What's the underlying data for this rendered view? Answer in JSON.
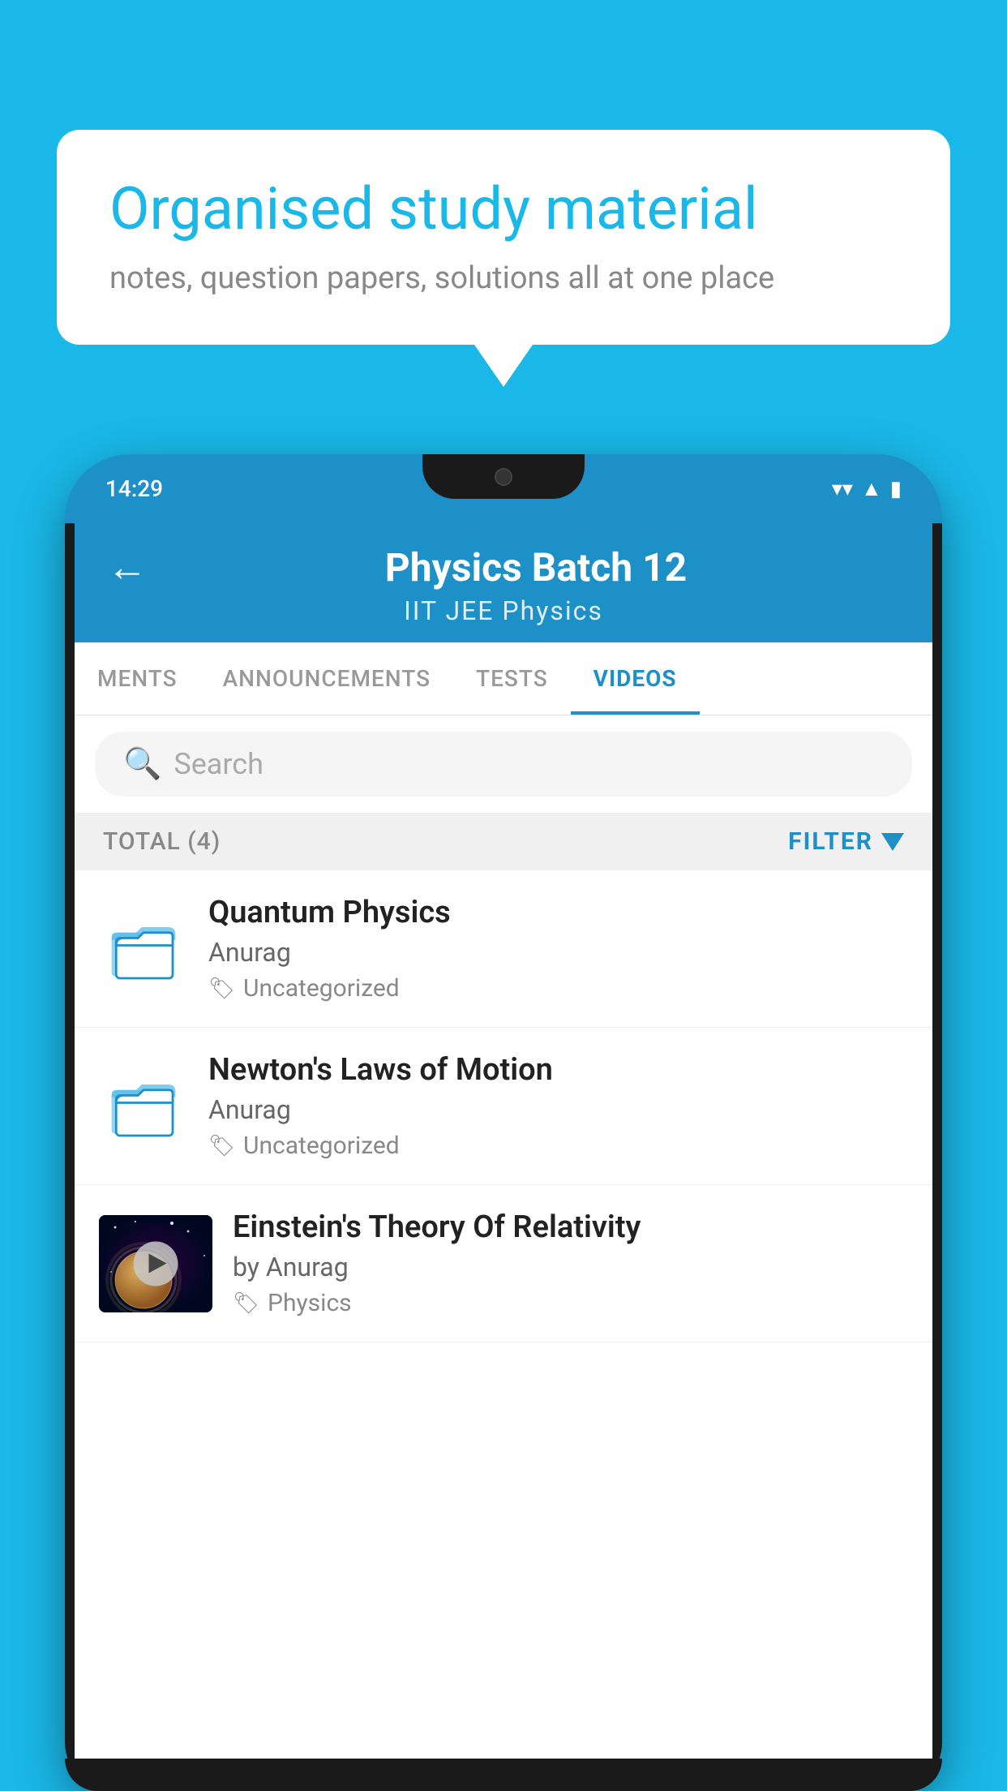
{
  "background_color": "#1ab8e8",
  "speech_bubble": {
    "title": "Organised study material",
    "subtitle": "notes, question papers, solutions all at one place"
  },
  "phone": {
    "status_bar": {
      "time": "14:29"
    },
    "header": {
      "title": "Physics Batch 12",
      "breadcrumb": "IIT JEE    Physics",
      "back_label": "←"
    },
    "tabs": [
      {
        "label": "MENTS",
        "active": false
      },
      {
        "label": "ANNOUNCEMENTS",
        "active": false
      },
      {
        "label": "TESTS",
        "active": false
      },
      {
        "label": "VIDEOS",
        "active": true
      }
    ],
    "search": {
      "placeholder": "Search"
    },
    "filter_bar": {
      "total_label": "TOTAL (4)",
      "filter_label": "FILTER"
    },
    "videos": [
      {
        "id": 1,
        "title": "Quantum Physics",
        "author": "Anurag",
        "tag": "Uncategorized",
        "type": "folder",
        "has_thumbnail": false
      },
      {
        "id": 2,
        "title": "Newton's Laws of Motion",
        "author": "Anurag",
        "tag": "Uncategorized",
        "type": "folder",
        "has_thumbnail": false
      },
      {
        "id": 3,
        "title": "Einstein's Theory Of Relativity",
        "author": "by Anurag",
        "tag": "Physics",
        "type": "video",
        "has_thumbnail": true
      }
    ]
  }
}
